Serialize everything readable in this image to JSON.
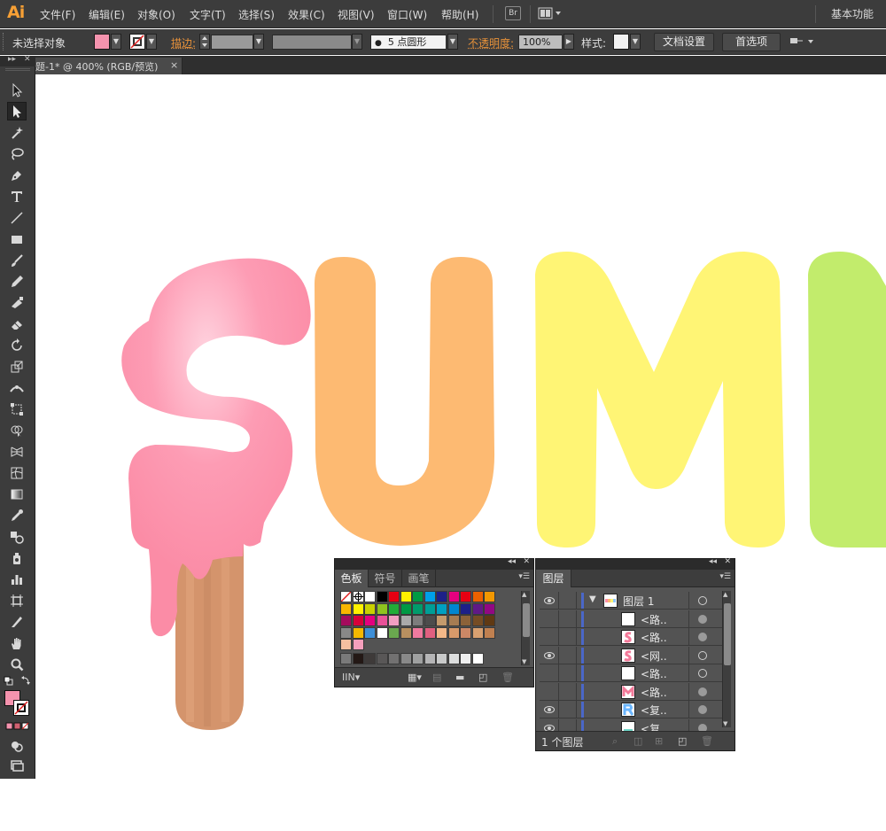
{
  "app": {
    "logo": "Ai",
    "workspace": "基本功能"
  },
  "menu": [
    "文件(F)",
    "编辑(E)",
    "对象(O)",
    "文字(T)",
    "选择(S)",
    "效果(C)",
    "视图(V)",
    "窗口(W)",
    "帮助(H)"
  ],
  "menubar_icons": {
    "bridge": "Br",
    "arrange": "arrange-documents-icon"
  },
  "controlbar": {
    "selection": "未选择对象",
    "fill_color": "#f593ae",
    "stroke_label": "描边:",
    "brush_dot": "●",
    "brush_value": "5 点圆形",
    "opacity_label": "不透明度:",
    "opacity_value": "100%",
    "style_label": "样式:",
    "doc_setup": "文档设置",
    "preferences": "首选项"
  },
  "document": {
    "tab_title": "题-1* @ 400% (RGB/预览)",
    "close": "×"
  },
  "tools": [
    "selection-arrow",
    "direct-selection",
    "magic-wand",
    "lasso",
    "pen",
    "type",
    "line-segment",
    "rectangle",
    "paintbrush",
    "pencil",
    "blob-brush",
    "eraser",
    "rotate",
    "scale",
    "width",
    "free-transform",
    "shape-builder",
    "perspective-grid",
    "mesh",
    "gradient",
    "eyedropper",
    "blend",
    "symbol-sprayer",
    "column-graph",
    "artboard",
    "slice",
    "hand",
    "zoom"
  ],
  "tool_fill_color": "#f593ae",
  "swatches_panel": {
    "tabs": [
      "色板",
      "符号",
      "画笔"
    ],
    "rows": [
      [
        "none",
        "registration",
        "#ffffff",
        "#000000",
        "#e60012",
        "#fff100",
        "#009944",
        "#00a0e9",
        "#1d2088",
        "#e4007f",
        "#e60012",
        "#eb6100",
        "#f39800"
      ],
      [
        "#f8b500",
        "#fff100",
        "#c9d100",
        "#8fc31f",
        "#22ac38",
        "#009944",
        "#009b6b",
        "#009e96",
        "#00a0c1",
        "#0086d1",
        "#1d2088",
        "#601986",
        "#920783"
      ],
      [
        "#a40b5d",
        "#d7003a",
        "#e4007f",
        "#e85298",
        "#f19ec2",
        "#aaaaaa",
        "#7d7d7d",
        "#4c4c4c",
        "#c49a6c",
        "#a67c52",
        "#8c6239",
        "#754c24",
        "#603913"
      ],
      [
        "#888888",
        "#f5b800",
        "#3d8fd8",
        "#ffffff",
        "#6aa84f",
        "#b89060",
        "#f07a9f",
        "#e06080",
        "#f3b888",
        "#d89a6a",
        "#cc8866",
        "#d8a070",
        "#c08050"
      ],
      [
        "#f6bfa0",
        "#f49fbc"
      ]
    ],
    "grays": [
      "#231815",
      "#3e3a39",
      "#595757",
      "#727171",
      "#898989",
      "#9fa0a0",
      "#b5b5b6",
      "#c9caca",
      "#dcdddd",
      "#efefef",
      "#ffffff"
    ]
  },
  "layers_panel": {
    "tab": "图层",
    "layers": [
      {
        "name": "图层 1",
        "eye": true,
        "expanded": true,
        "thumb": "summer"
      },
      {
        "name": "<路..",
        "eye": false,
        "thumb": "blank"
      },
      {
        "name": "<路..",
        "eye": false,
        "thumb": "pink-s"
      },
      {
        "name": "<网..",
        "eye": true,
        "thumb": "pink-s"
      },
      {
        "name": "<路..",
        "eye": false,
        "thumb": "blank"
      },
      {
        "name": "<路..",
        "eye": false,
        "thumb": "pink-m"
      },
      {
        "name": "<复..",
        "eye": true,
        "thumb": "blue-r"
      },
      {
        "name": "<复..",
        "eye": true,
        "thumb": "teal"
      }
    ],
    "count": "1 个图层"
  },
  "artwork": {
    "letters": [
      "S",
      "U",
      "M",
      "M"
    ],
    "colors": [
      "#fb8ca6",
      "#fdba72",
      "#fff575",
      "#c2ec6c"
    ],
    "stick_color": "#d4946c"
  }
}
